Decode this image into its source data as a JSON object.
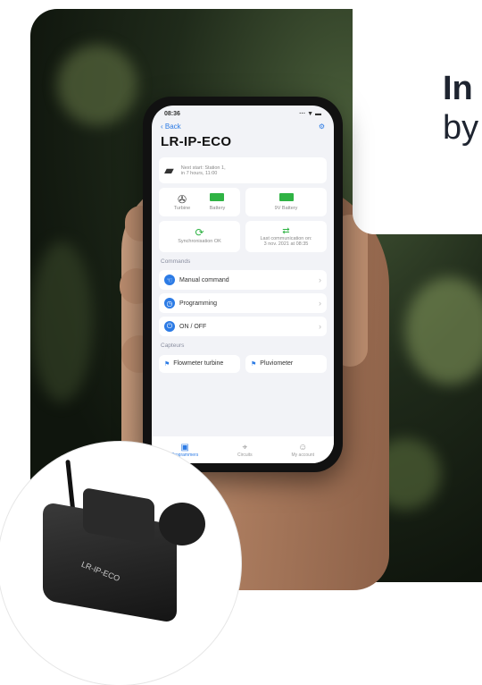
{
  "headline": {
    "bold": "In",
    "regular": "by"
  },
  "phone": {
    "status_time": "08:36",
    "status_icons": "··· ▼ ▬",
    "back_label": "Back",
    "settings_icon": "gear-icon",
    "device_name": "LR-IP-ECO",
    "next_start": "Next start: Station 1,",
    "next_start_time": "in 7 hours, 11:00",
    "tiles": {
      "turbine": "Turbine",
      "battery": "Battery",
      "battery_9v": "9V Battery",
      "sync": "Synchronisation OK",
      "last_comm": "Last communication on:",
      "last_comm_date": "3 nov. 2021 at 08:35"
    },
    "commands_header": "Commands",
    "commands": [
      {
        "label": "Manual command",
        "icon": "hand-icon"
      },
      {
        "label": "Programming",
        "icon": "clock-icon"
      },
      {
        "label": "ON / OFF",
        "icon": "power-icon"
      }
    ],
    "sensors_header": "Capteurs",
    "sensors": [
      {
        "label": "Flowmeter turbine"
      },
      {
        "label": "Pluviometer"
      }
    ],
    "tabs": [
      {
        "label": "Programmers",
        "icon": "programmer-icon"
      },
      {
        "label": "Circuits",
        "icon": "map-icon"
      },
      {
        "label": "My account",
        "icon": "user-icon"
      }
    ]
  },
  "device": {
    "label": "LR-IP-ECO"
  }
}
